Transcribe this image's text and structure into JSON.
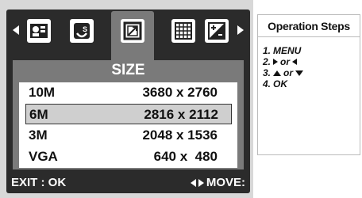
{
  "screen": {
    "panel_title": "SIZE",
    "icons": [
      "person-id-icon",
      "scene-mode-icon",
      "size-icon",
      "quality-grid-icon",
      "exposure-icon"
    ],
    "selected_icon": "size-icon",
    "sizes": [
      {
        "label": "10M",
        "resolution": "3680 x 2760"
      },
      {
        "label": "6M",
        "resolution": "2816 x 2112"
      },
      {
        "label": "3M",
        "resolution": "2048 x 1536"
      },
      {
        "label": "VGA",
        "resolution": "640 x  480"
      }
    ],
    "selected_size": "6M",
    "footer": {
      "exit": "EXIT : OK",
      "move": "MOVE:"
    }
  },
  "steps": {
    "title": "Operation Steps",
    "items": [
      {
        "num": "1.",
        "text": "MENU"
      },
      {
        "num": "2.",
        "text": "or"
      },
      {
        "num": "3.",
        "text": "or"
      },
      {
        "num": "4.",
        "text": "OK"
      }
    ]
  },
  "colors": {
    "lcd": "#2b2b2b",
    "panel": "#7a7a7a",
    "selected_row": "#cfcfcf"
  }
}
